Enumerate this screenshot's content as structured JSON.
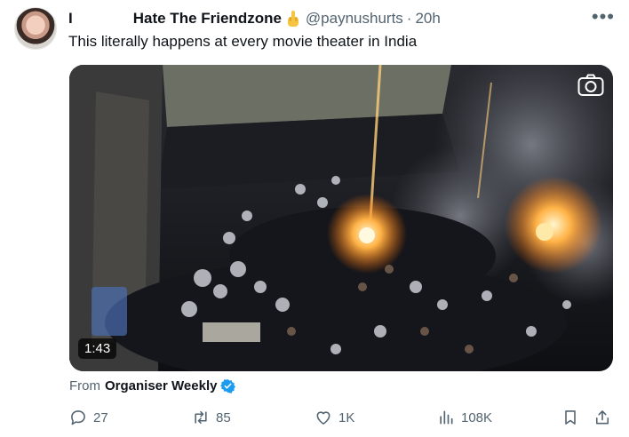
{
  "post": {
    "display_name_left": "I",
    "display_name": "Hate The Friendzone",
    "handle": "@paynushurts",
    "separator": "·",
    "time": "20h",
    "text": "This literally happens at every movie theater in India",
    "more_icon": "more-horizontal-icon"
  },
  "media": {
    "duration": "1:43",
    "camera_icon": "camera-icon",
    "from_label": "From",
    "source_name": "Organiser Weekly",
    "verified_icon": "verified-badge-icon",
    "verified_color": "#1d9bf0"
  },
  "actions": {
    "replies": "27",
    "reposts": "85",
    "likes": "1K",
    "views": "108K"
  },
  "colors": {
    "text": "#0f1419",
    "secondary": "#536471"
  }
}
